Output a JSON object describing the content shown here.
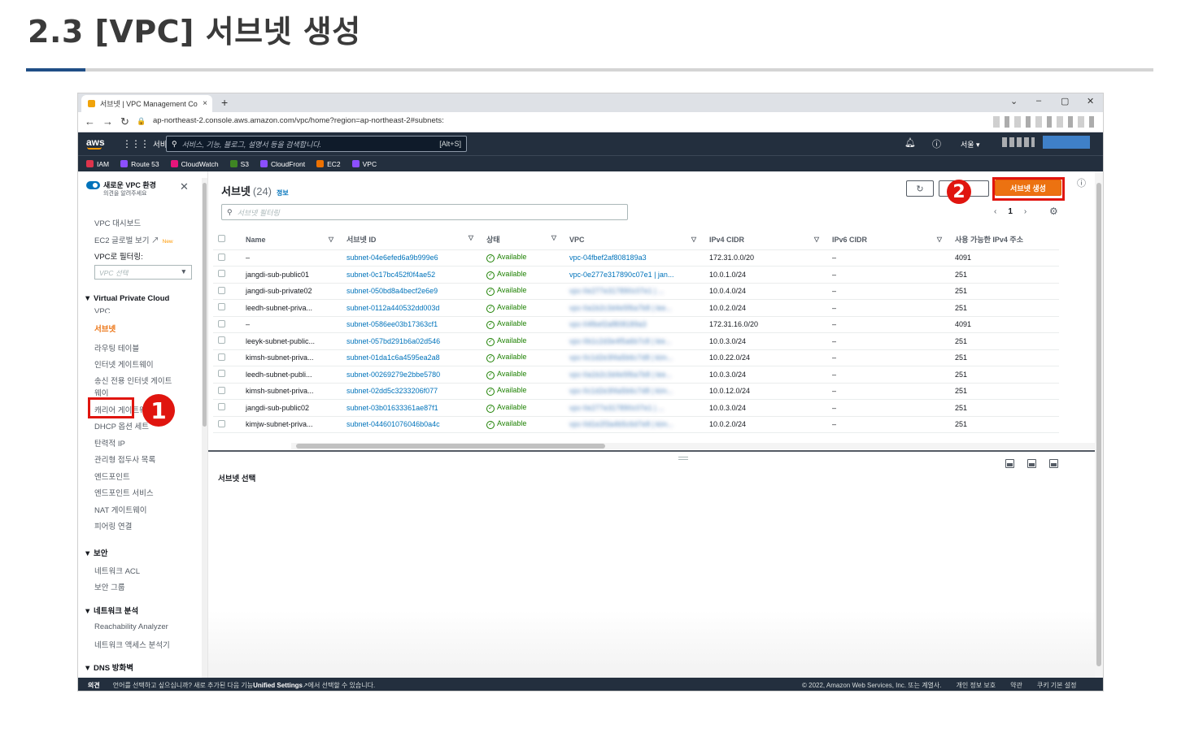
{
  "slide": {
    "title": "2.3 [VPC] 서브넷 생성"
  },
  "browser": {
    "tab_title": "서브넷 | VPC Management Con",
    "tab_close": "×",
    "new_tab": "+",
    "url": "ap-northeast-2.console.aws.amazon.com/vpc/home?region=ap-northeast-2#subnets:",
    "minimize": "–",
    "maximize": "▢",
    "close": "✕",
    "collapse": "⌄"
  },
  "aws_header": {
    "logo": "aws",
    "services_label": "서비스",
    "search_placeholder": "서비스, 기능, 블로그, 설명서 등을 검색합니다.",
    "search_shortcut": "[Alt+S]",
    "region": "서울 ▾",
    "favorites": [
      {
        "label": "IAM",
        "color": "#dd344c"
      },
      {
        "label": "Route 53",
        "color": "#8c4fff"
      },
      {
        "label": "CloudWatch",
        "color": "#e7157b"
      },
      {
        "label": "S3",
        "color": "#3f8624"
      },
      {
        "label": "CloudFront",
        "color": "#8c4fff"
      },
      {
        "label": "EC2",
        "color": "#ed7100"
      },
      {
        "label": "VPC",
        "color": "#8c4fff"
      }
    ]
  },
  "sidebar": {
    "new_experience": "새로운 VPC 환경",
    "new_experience_sub": "의견을 알려주세요",
    "close": "✕",
    "dashboard": "VPC 대시보드",
    "global_view": "EC2 글로벌 보기",
    "new_badge": "New",
    "filter_label": "VPC로 필터링:",
    "vpc_select_placeholder": "VPC 선택",
    "section_vpc": "▼ Virtual Private Cloud",
    "items_vpc": [
      "VPC",
      "서브넷",
      "라우팅 테이블",
      "인터넷 게이트웨이",
      "송신 전용 인터넷 게이트",
      "웨이",
      "캐리어 게이트웨이",
      "DHCP 옵션 세트",
      "탄력적 IP",
      "관리형 접두사 목록",
      "엔드포인트",
      "엔드포인트 서비스",
      "NAT 게이트웨이",
      "피어링 연결"
    ],
    "section_security": "▼ 보안",
    "items_security": [
      "네트워크 ACL",
      "보안 그룹"
    ],
    "section_analysis": "▼ 네트워크 분석",
    "items_analysis": [
      "Reachability Analyzer",
      "네트워크 액세스 분석기"
    ],
    "section_dns": "▼ DNS 방화벽"
  },
  "markers": {
    "one": "1",
    "two": "2"
  },
  "main": {
    "title": "서브넷",
    "count": "(24)",
    "info": "정보",
    "filter_placeholder": "서브넷 필터링",
    "create_button": "서브넷 생성",
    "page_number": "1",
    "detail_label": "서브넷 선택",
    "columns": [
      "Name",
      "서브넷 ID",
      "상태",
      "VPC",
      "IPv4 CIDR",
      "IPv6 CIDR",
      "사용 가능한 IPv4 주소"
    ],
    "rows": [
      {
        "name": "–",
        "id": "subnet-04e6efed6a9b999e6",
        "state": "Available",
        "vpc": "vpc-04fbef2af808189a3",
        "cidr": "172.31.0.0/20",
        "ipv6": "–",
        "avail": "4091",
        "blur": false
      },
      {
        "name": "jangdi-sub-public01",
        "id": "subnet-0c17bc452f0f4ae52",
        "state": "Available",
        "vpc": "vpc-0e277e317890c07e1 | jan...",
        "cidr": "10.0.1.0/24",
        "ipv6": "–",
        "avail": "251",
        "blur": false
      },
      {
        "name": "jangdi-sub-private02",
        "id": "subnet-050bd8a4becf2e6e9",
        "state": "Available",
        "vpc": "vpc-0e277e317890c07e1 | ...",
        "cidr": "10.0.4.0/24",
        "ipv6": "–",
        "avail": "251",
        "blur": true
      },
      {
        "name": "leedh-subnet-priva...",
        "id": "subnet-0112a440532dd003d",
        "state": "Available",
        "vpc": "vpc-0a1b2c3d4e5f6a7b8 | lee...",
        "cidr": "10.0.2.0/24",
        "ipv6": "–",
        "avail": "251",
        "blur": true
      },
      {
        "name": "–",
        "id": "subnet-0586ee03b17363cf1",
        "state": "Available",
        "vpc": "vpc-04fbef2af808189a3",
        "cidr": "172.31.16.0/20",
        "ipv6": "–",
        "avail": "4091",
        "blur": true
      },
      {
        "name": "leeyk-subnet-public...",
        "id": "subnet-057bd291b6a02d546",
        "state": "Available",
        "vpc": "vpc-0b1c2d3e4f5a6b7c8 | lee...",
        "cidr": "10.0.3.0/24",
        "ipv6": "–",
        "avail": "251",
        "blur": true
      },
      {
        "name": "kimsh-subnet-priva...",
        "id": "subnet-01da1c6a4595ea2a8",
        "state": "Available",
        "vpc": "vpc-0c1d2e3f4a5b6c7d8 | kim...",
        "cidr": "10.0.22.0/24",
        "ipv6": "–",
        "avail": "251",
        "blur": true
      },
      {
        "name": "leedh-subnet-publi...",
        "id": "subnet-00269279e2bbe5780",
        "state": "Available",
        "vpc": "vpc-0a1b2c3d4e5f6a7b8 | lee...",
        "cidr": "10.0.3.0/24",
        "ipv6": "–",
        "avail": "251",
        "blur": true
      },
      {
        "name": "kimsh-subnet-priva...",
        "id": "subnet-02dd5c3233206f077",
        "state": "Available",
        "vpc": "vpc-0c1d2e3f4a5b6c7d8 | kim...",
        "cidr": "10.0.12.0/24",
        "ipv6": "–",
        "avail": "251",
        "blur": true
      },
      {
        "name": "jangdi-sub-public02",
        "id": "subnet-03b01633361ae87f1",
        "state": "Available",
        "vpc": "vpc-0e277e317890c07e1 | ...",
        "cidr": "10.0.3.0/24",
        "ipv6": "–",
        "avail": "251",
        "blur": true
      },
      {
        "name": "kimjw-subnet-priva...",
        "id": "subnet-044601076046b0a4c",
        "state": "Available",
        "vpc": "vpc-0d1e2f3a4b5c6d7e8 | kim...",
        "cidr": "10.0.2.0/24",
        "ipv6": "–",
        "avail": "251",
        "blur": true
      }
    ]
  },
  "footer": {
    "feedback": "의견",
    "message_prefix": "언어를 선택하고 싶으십니까? 새로 추가된 다음 기능",
    "unified_settings": "Unified Settings",
    "message_suffix": "에서 선택할 수 있습니다.",
    "copyright": "© 2022, Amazon Web Services, Inc. 또는 계열사.",
    "privacy": "개인 정보 보호",
    "terms": "약관",
    "cookies": "쿠키 기본 설정"
  },
  "colors": {
    "accent_orange": "#ec7211",
    "marker_red": "#e0150f",
    "aws_dark": "#232f3e",
    "link_blue": "#0073bb"
  }
}
